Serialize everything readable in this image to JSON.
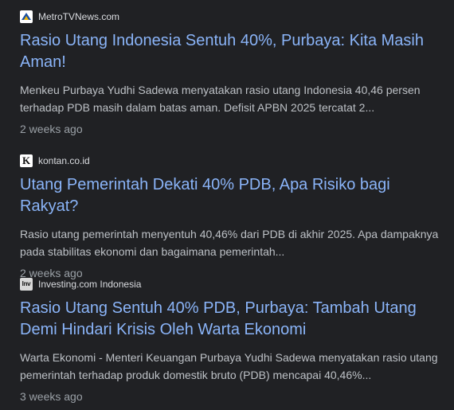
{
  "results": [
    {
      "source": "MetroTVNews.com",
      "favicon_icon": "metrotv-logo-icon",
      "title": "Rasio Utang Indonesia Sentuh 40%, Purbaya: Kita Masih Aman!",
      "snippet": "Menkeu Purbaya Yudhi Sadewa menyatakan rasio utang Indonesia 40,46 persen terhadap PDB masih dalam batas aman. Defisit APBN 2025 tercatat 2...",
      "age": "2 weeks ago"
    },
    {
      "source": "kontan.co.id",
      "favicon_icon": "kontan-logo-icon",
      "favicon_letter": "K",
      "title": "Utang Pemerintah Dekati 40% PDB, Apa Risiko bagi Rakyat?",
      "snippet": "Rasio utang pemerintah menyentuh 40,46% dari PDB di akhir 2025. Apa dampaknya pada stabilitas ekonomi dan bagaimana pemerintah...",
      "age": "2 weeks ago"
    },
    {
      "source": "Investing.com Indonesia",
      "favicon_icon": "investing-logo-icon",
      "favicon_letter": "Inv",
      "title": "Rasio Utang Sentuh 40% PDB, Purbaya: Tambah Utang Demi Hindari Krisis Oleh Warta Ekonomi",
      "snippet": "Warta Ekonomi - Menteri Keuangan Purbaya Yudhi Sadewa menyatakan rasio utang pemerintah terhadap produk domestik bruto (PDB) mencapai 40,46%...",
      "age": "3 weeks ago"
    }
  ],
  "colors": {
    "background": "#202124",
    "title_link": "#8ab4f8",
    "snippet_text": "#bdc1c6",
    "meta_text": "#9aa0a6",
    "source_text": "#dadce0"
  }
}
